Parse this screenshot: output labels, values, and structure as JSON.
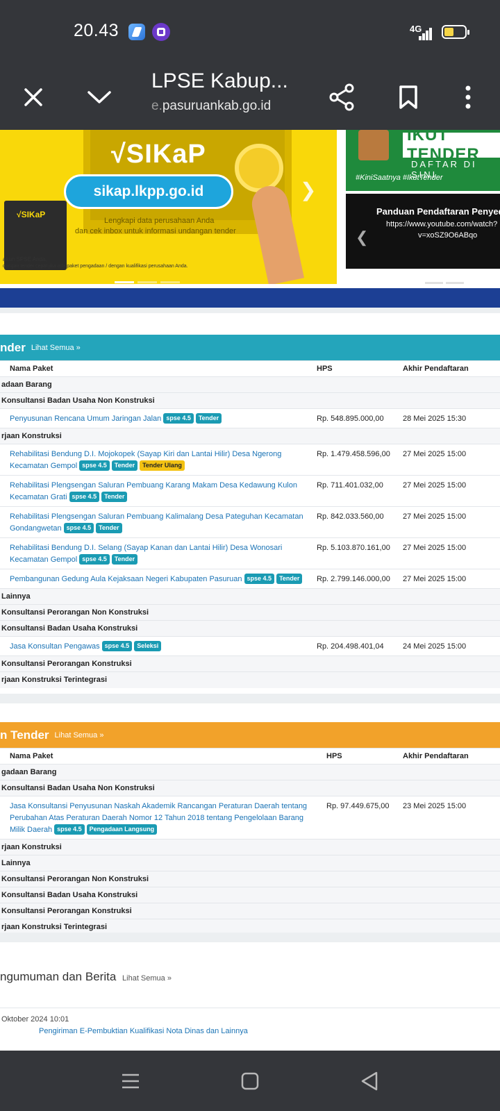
{
  "status": {
    "time": "20.43",
    "network": "4G"
  },
  "toolbar": {
    "title": "LPSE Kabup...",
    "url_prefix": "e.",
    "url": "pasuruankab.go.id"
  },
  "banner": {
    "logo": "√SIKaP",
    "pill": "sikap.lkpp.go.id",
    "sub1": "Lengkapi data perusahaan Anda",
    "sub2": "dan cek inbox untuk informasi undangan tender",
    "book_logo": "√SIKaP",
    "small1": "akun SPSE Anda.",
    "small2": "dangan tender cepat jika ada paket pengadaan / dengan kualifikasi perusahaan Anda.",
    "right_ikut": "IKUT TENDER",
    "right_daftar": "DAFTAR DI SINI",
    "right_hashtag": "#KiniSaatnya #IkutTender",
    "right_panduan": "Panduan Pendaftaran Penyedia",
    "right_yt1": "https://www.youtube.com/watch?",
    "right_yt2": "v=xoSZ9O6ABqo"
  },
  "tender_panel": {
    "title": "nder",
    "link": "Lihat Semua »",
    "col_name": "Nama Paket",
    "col_hps": "HPS",
    "col_akhir": "Akhir Pendaftaran",
    "rows": [
      {
        "type": "cat",
        "label": "adaan Barang"
      },
      {
        "type": "cat",
        "label": "Konsultansi Badan Usaha Non Konstruksi"
      },
      {
        "type": "item",
        "name": "Penyusunan Rencana Umum Jaringan Jalan",
        "badges": [
          "spse 4.5",
          "Tender"
        ],
        "hps": "Rp. 548.895.000,00",
        "akhir": "28 Mei 2025 15:30"
      },
      {
        "type": "cat",
        "label": "rjaan Konstruksi"
      },
      {
        "type": "item",
        "name": "Rehabilitasi Bendung D.I. Mojokopek (Sayap Kiri dan Lantai Hilir) Desa Ngerong Kecamatan Gempol",
        "badges": [
          "spse 4.5",
          "Tender",
          "Tender Ulang"
        ],
        "hps": "Rp. 1.479.458.596,00",
        "akhir": "27 Mei 2025 15:00"
      },
      {
        "type": "item",
        "name": "Rehabilitasi Plengsengan Saluran Pembuang Karang Makam Desa Kedawung Kulon Kecamatan Grati",
        "badges": [
          "spse 4.5",
          "Tender"
        ],
        "hps": "Rp. 711.401.032,00",
        "akhir": "27 Mei 2025 15:00"
      },
      {
        "type": "item",
        "name": "Rehabilitasi Plengsengan Saluran Pembuang Kalimalang Desa Pateguhan Kecamatan Gondangwetan",
        "badges": [
          "spse 4.5",
          "Tender"
        ],
        "hps": "Rp. 842.033.560,00",
        "akhir": "27 Mei 2025 15:00"
      },
      {
        "type": "item",
        "name": "Rehabilitasi Bendung D.I. Selang (Sayap Kanan dan Lantai Hilir) Desa Wonosari Kecamatan Gempol",
        "badges": [
          "spse 4.5",
          "Tender"
        ],
        "hps": "Rp. 5.103.870.161,00",
        "akhir": "27 Mei 2025 15:00"
      },
      {
        "type": "item",
        "name": "Pembangunan Gedung Aula Kejaksaan Negeri Kabupaten Pasuruan",
        "badges": [
          "spse 4.5",
          "Tender"
        ],
        "hps": "Rp. 2.799.146.000,00",
        "akhir": "27 Mei 2025 15:00"
      },
      {
        "type": "cat",
        "label": "Lainnya"
      },
      {
        "type": "cat",
        "label": "Konsultansi Perorangan Non Konstruksi"
      },
      {
        "type": "cat",
        "label": "Konsultansi Badan Usaha Konstruksi"
      },
      {
        "type": "item",
        "name": "Jasa Konsultan Pengawas",
        "badges": [
          "spse 4.5",
          "Seleksi"
        ],
        "hps": "Rp. 204.498.401,04",
        "akhir": "24 Mei 2025 15:00"
      },
      {
        "type": "cat",
        "label": "Konsultansi Perorangan Konstruksi"
      },
      {
        "type": "cat",
        "label": "rjaan Konstruksi Terintegrasi"
      }
    ]
  },
  "nontender_panel": {
    "title": "n Tender",
    "link": "Lihat Semua »",
    "col_name": "Nama Paket",
    "col_hps": "HPS",
    "col_akhir": "Akhir Pendaftaran",
    "rows": [
      {
        "type": "cat",
        "label": "gadaan Barang"
      },
      {
        "type": "cat",
        "label": "Konsultansi Badan Usaha Non Konstruksi"
      },
      {
        "type": "item",
        "name": "Jasa Konsultansi Penyusunan Naskah Akademik Rancangan Peraturan Daerah tentang Perubahan Atas Peraturan Daerah Nomor 12 Tahun 2018 tentang Pengelolaan Barang Milik Daerah",
        "badges": [
          "spse 4.5",
          "Pengadaan Langsung"
        ],
        "hps": "Rp. 97.449.675,00",
        "akhir": "23 Mei 2025 15:00"
      },
      {
        "type": "cat",
        "label": "rjaan Konstruksi"
      },
      {
        "type": "cat",
        "label": "Lainnya"
      },
      {
        "type": "cat",
        "label": "Konsultansi Perorangan Non Konstruksi"
      },
      {
        "type": "cat",
        "label": "Konsultansi Badan Usaha Konstruksi"
      },
      {
        "type": "cat",
        "label": "Konsultansi Perorangan Konstruksi"
      },
      {
        "type": "cat",
        "label": "rjaan Konstruksi Terintegrasi"
      }
    ]
  },
  "pengumuman": {
    "title": "ngumuman dan Berita",
    "link": "Lihat Semua »",
    "date": "Oktober 2024 10:01",
    "text": "Pengiriman E-Pembuktian Kualifikasi Nota Dinas dan Lainnya"
  },
  "colors": {
    "chrome": "#34363a",
    "teal": "#24a5bb",
    "orange": "#f2a22a",
    "link": "#1a73b5",
    "badge": "#1a9bb3",
    "badge_yellow": "#f3c213",
    "navy": "#1c3f94"
  },
  "icons": {
    "close": "close-icon",
    "collapse": "chevron-down-icon",
    "share": "share-icon",
    "bookmark": "bookmark-icon",
    "menu": "more-vertical-icon",
    "nav_menu": "recents-icon",
    "nav_home": "home-icon",
    "nav_back": "back-icon"
  }
}
